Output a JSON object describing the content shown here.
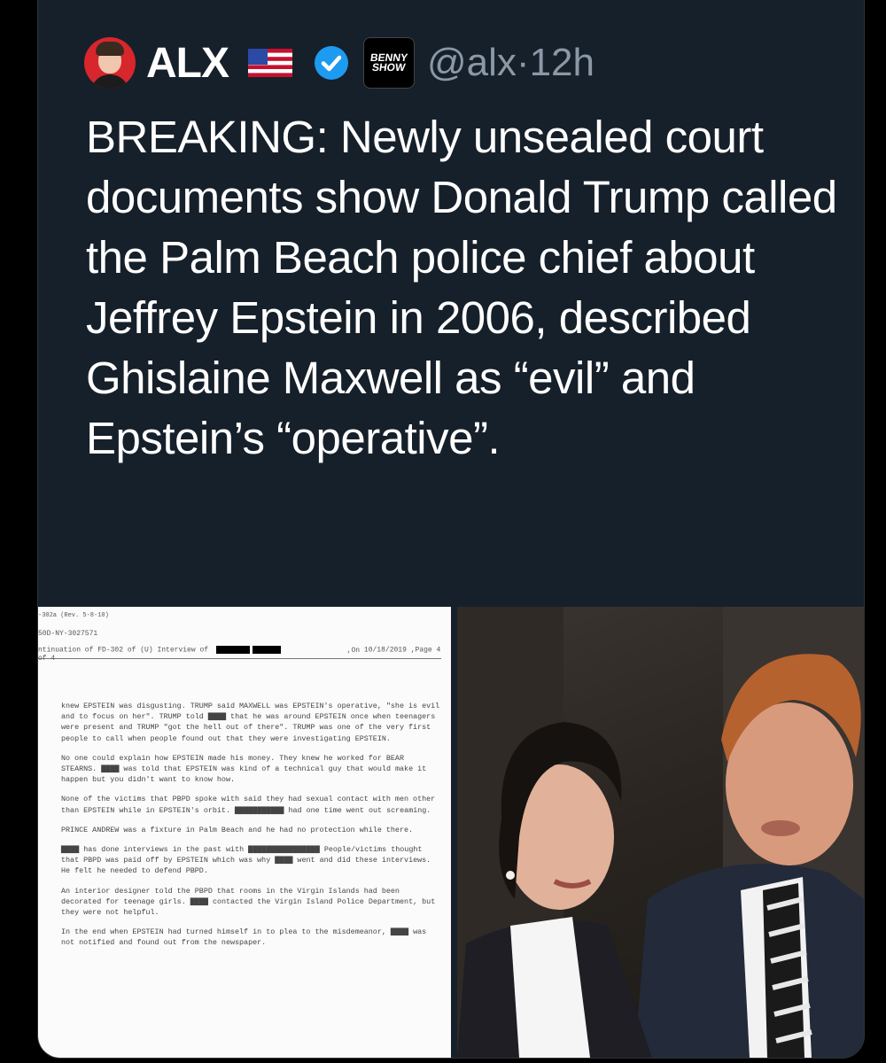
{
  "tweet": {
    "display_name": "ALX",
    "badge_text": "BENNY SHOW",
    "handle": "@alx",
    "separator": "·",
    "time": "12h",
    "text": "BREAKING: Newly unsealed court documents show Donald Trump called the Palm Beach police chief about Jeffrey Epstein in 2006, described Ghislaine Maxwell as “evil” and Epstein’s “operative”."
  },
  "document": {
    "form_id": "-302a (Rev. 5-8-10)",
    "file_no": "50D-NY-3027571",
    "continuation": "ntinuation of FD-302 of",
    "interview": "(U) Interview of",
    "on_label": ",On",
    "date": "10/18/2019",
    "page_label": ",Page",
    "page": "4 of 4",
    "paragraphs": [
      "knew EPSTEIN was disgusting. TRUMP said MAXWELL was EPSTEIN's operative, \"she is evil and to focus on her\". TRUMP told ▇▇▇▇ that he was around EPSTEIN once when teenagers were present and TRUMP \"got the hell out of there\". TRUMP was one of the very first people to call when people found out that they were investigating EPSTEIN.",
      "No one could explain how EPSTEIN made his money. They knew he worked for BEAR STEARNS. ▇▇▇▇ was told that EPSTEIN was kind of a technical guy that would make it happen but you didn't want to know how.",
      "None of the victims that PBPD spoke with said they had sexual contact with men other than EPSTEIN while in EPSTEIN's orbit. ▇▇▇▇▇▇▇▇▇▇▇ had one time went out screaming.",
      "PRINCE ANDREW was a fixture in Palm Beach and he had no protection while there.",
      "▇▇▇▇ has done interviews in the past with ▇▇▇▇▇▇▇▇▇▇▇▇▇▇▇▇ People/victims thought that PBPD was paid off by EPSTEIN which was why ▇▇▇▇ went and did these interviews. He felt he needed to defend PBPD.",
      "An interior designer told the PBPD that rooms in the Virgin Islands had been decorated for teenage girls. ▇▇▇▇ contacted the Virgin Island Police Department, but they were not helpful.",
      "In the end when EPSTEIN had turned himself in to plea to the misdemeanor, ▇▇▇▇ was not notified and found out from the newspaper."
    ]
  },
  "icons": [
    "avatar",
    "us-flag-icon",
    "verified-check-icon",
    "benny-show-badge-icon"
  ],
  "colors": {
    "card_bg": "#16202a",
    "handle": "#8b98a5",
    "verified": "#1d9bf0"
  }
}
